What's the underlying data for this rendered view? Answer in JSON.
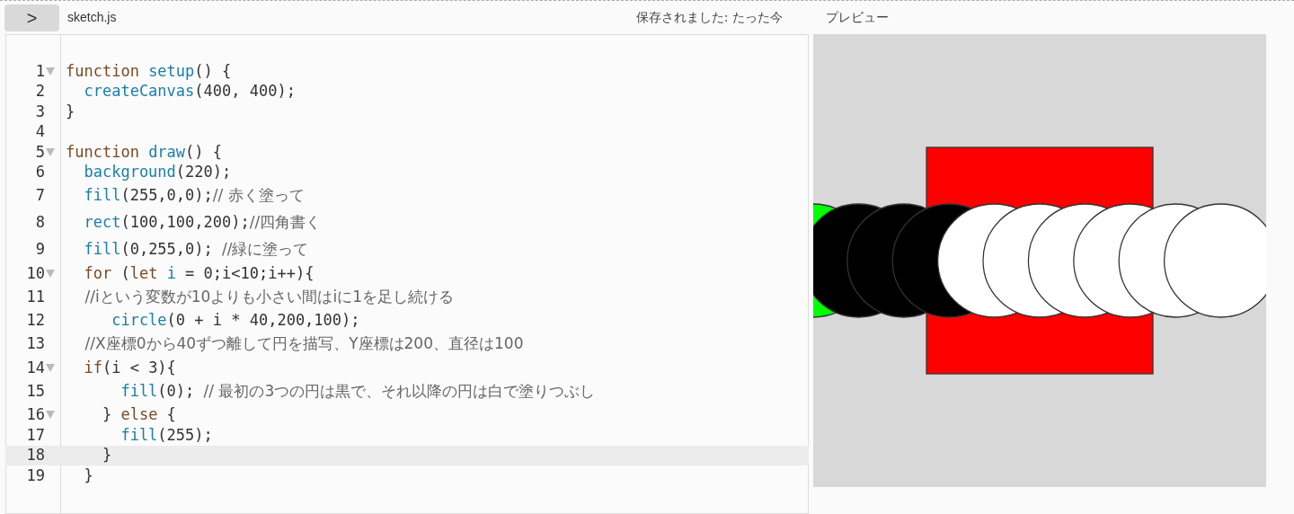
{
  "toolbar": {
    "toggle_button": ">",
    "file_name": "sketch.js",
    "save_status": "保存されました: たった今"
  },
  "editor": {
    "lines": [
      {
        "number": "1",
        "foldable": true,
        "active": false,
        "tokens": [
          {
            "kind": "keyword",
            "text": "function "
          },
          {
            "kind": "def",
            "text": "setup"
          },
          {
            "kind": "plain",
            "text": "() {"
          }
        ]
      },
      {
        "number": "2",
        "foldable": false,
        "active": false,
        "tokens": [
          {
            "kind": "def",
            "text": "  createCanvas"
          },
          {
            "kind": "plain",
            "text": "(400, 400);"
          }
        ]
      },
      {
        "number": "3",
        "foldable": false,
        "active": false,
        "tokens": [
          {
            "kind": "plain",
            "text": "}"
          }
        ]
      },
      {
        "number": "4",
        "foldable": false,
        "active": false
      },
      {
        "number": "5",
        "foldable": true,
        "active": false,
        "tokens": [
          {
            "kind": "keyword",
            "text": "function "
          },
          {
            "kind": "def",
            "text": "draw"
          },
          {
            "kind": "plain",
            "text": "() {"
          }
        ]
      },
      {
        "number": "6",
        "foldable": false,
        "active": false,
        "tokens": [
          {
            "kind": "def",
            "text": "  background"
          },
          {
            "kind": "plain",
            "text": "(220);"
          }
        ]
      },
      {
        "number": "7",
        "foldable": false,
        "active": false,
        "tokens": [
          {
            "kind": "def",
            "text": "  fill"
          },
          {
            "kind": "plain",
            "text": "(255,0,0);"
          },
          {
            "kind": "comment",
            "text": "// 赤く塗って"
          }
        ]
      },
      {
        "number": "8",
        "foldable": false,
        "active": false,
        "tokens": [
          {
            "kind": "def",
            "text": "  rect"
          },
          {
            "kind": "plain",
            "text": "(100,100,200);"
          },
          {
            "kind": "comment",
            "text": "//四角書く"
          }
        ]
      },
      {
        "number": "9",
        "foldable": false,
        "active": false,
        "tokens": [
          {
            "kind": "def",
            "text": "  fill"
          },
          {
            "kind": "plain",
            "text": "(0,255,0); "
          },
          {
            "kind": "comment",
            "text": "//緑に塗って"
          }
        ]
      },
      {
        "number": "10",
        "foldable": true,
        "active": false,
        "tokens": [
          {
            "kind": "keyword",
            "text": "  for"
          },
          {
            "kind": "plain",
            "text": " ("
          },
          {
            "kind": "keyword",
            "text": "let"
          },
          {
            "kind": "def",
            "text": " i"
          },
          {
            "kind": "plain",
            "text": " = 0;i<10;i++){"
          }
        ]
      },
      {
        "number": "11",
        "foldable": false,
        "active": false,
        "tokens": [
          {
            "kind": "comment",
            "text": "    //iという変数が10よりも小さい間はiに1を足し続ける"
          }
        ]
      },
      {
        "number": "12",
        "foldable": false,
        "active": false,
        "tokens": [
          {
            "kind": "def",
            "text": "     circle"
          },
          {
            "kind": "plain",
            "text": "(0 + i * 40,200,100);"
          }
        ]
      },
      {
        "number": "13",
        "foldable": false,
        "active": false,
        "tokens": [
          {
            "kind": "comment",
            "text": "    //X座標0から40ずつ離して円を描写、Y座標は200、直径は100"
          }
        ]
      },
      {
        "number": "14",
        "foldable": true,
        "active": false,
        "tokens": [
          {
            "kind": "keyword",
            "text": "  if"
          },
          {
            "kind": "plain",
            "text": "(i < 3){"
          }
        ]
      },
      {
        "number": "15",
        "foldable": false,
        "active": false,
        "tokens": [
          {
            "kind": "def",
            "text": "      fill"
          },
          {
            "kind": "plain",
            "text": "(0); "
          },
          {
            "kind": "comment",
            "text": "// 最初の3つの円は黒で、それ以降の円は白で塗りつぶし"
          }
        ]
      },
      {
        "number": "16",
        "foldable": true,
        "active": false,
        "tokens": [
          {
            "kind": "plain",
            "text": "    } "
          },
          {
            "kind": "keyword",
            "text": "else"
          },
          {
            "kind": "plain",
            "text": " {"
          }
        ]
      },
      {
        "number": "17",
        "foldable": false,
        "active": false,
        "tokens": [
          {
            "kind": "def",
            "text": "      fill"
          },
          {
            "kind": "plain",
            "text": "(255);"
          }
        ]
      },
      {
        "number": "18",
        "foldable": false,
        "active": true,
        "tokens": [
          {
            "kind": "plain",
            "text": "    }"
          }
        ]
      },
      {
        "number": "19",
        "foldable": false,
        "active": false,
        "tokens": [
          {
            "kind": "plain",
            "text": "  }"
          }
        ]
      }
    ]
  },
  "preview": {
    "title": "プレビュー",
    "shapes": [
      {
        "kind": "rect",
        "color": "#ff0000"
      },
      {
        "kind": "circle",
        "color": "#00ff00"
      },
      {
        "kind": "circle",
        "color": "#000000"
      },
      {
        "kind": "circle",
        "color": "#000000"
      },
      {
        "kind": "circle",
        "color": "#000000"
      },
      {
        "kind": "circle",
        "color": "#ffffff"
      },
      {
        "kind": "circle",
        "color": "#ffffff"
      },
      {
        "kind": "circle",
        "color": "#ffffff"
      },
      {
        "kind": "circle",
        "color": "#ffffff"
      },
      {
        "kind": "circle",
        "color": "#ffffff"
      },
      {
        "kind": "circle",
        "color": "#ffffff"
      }
    ]
  }
}
